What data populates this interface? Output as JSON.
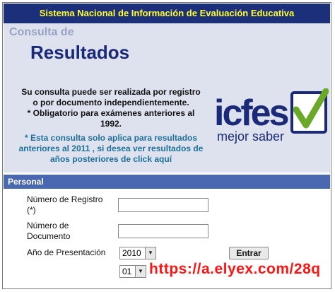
{
  "header": {
    "title": "Sistema Nacional de Información de Evaluación Educativa"
  },
  "intro": {
    "consulta": "Consulta de",
    "resultados": "Resultados",
    "message_lines": [
      "Su consulta puede ser realizada por registro",
      "o por documento independientemente.",
      "* Obligatorio para exámenes anteriores al",
      "1992."
    ],
    "note_lines": [
      "* Esta consulta solo aplica para resultados",
      "anteriores al 2011 , si desea ver resultados de",
      "años posteriores de click aquí"
    ]
  },
  "logo": {
    "brand": "icfes",
    "tagline": "mejor saber",
    "check_color": "#6aa827",
    "brand_color": "#1a2a78"
  },
  "section": {
    "title": "Personal"
  },
  "form": {
    "registro_label_1": "Número de Registro",
    "registro_label_2": "(*)",
    "registro_value": "",
    "documento_label_1": "Número de",
    "documento_label_2": "Documento",
    "documento_value": "",
    "anio_label": "Año de Presentación",
    "anio_selected": "2010",
    "periodo_selected": "01",
    "submit_label": "Entrar"
  },
  "watermark": {
    "url": "https://a.elyex.com/28q"
  },
  "colors": {
    "header_bg": "#1c2f7a",
    "header_text": "#ffff33",
    "section_bg": "#4a67b2",
    "intro_bg": "#dde2ee"
  }
}
